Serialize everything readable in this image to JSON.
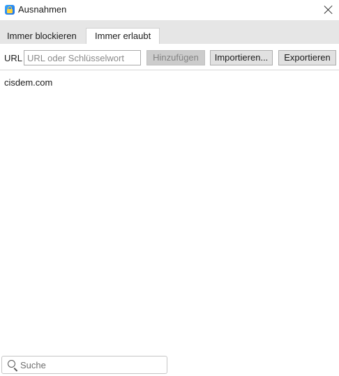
{
  "window": {
    "title": "Ausnahmen",
    "close_icon": "close-icon",
    "app_icon": "lock-icon"
  },
  "tabs": [
    {
      "label": "Immer blockieren",
      "active": false
    },
    {
      "label": "Immer erlaubt",
      "active": true
    }
  ],
  "toolbar": {
    "url_label": "URL",
    "url_value": "",
    "url_placeholder": "URL oder Schlüsselwort",
    "add_label": "Hinzufügen",
    "add_enabled": false,
    "import_label": "Importieren...",
    "export_label": "Exportieren"
  },
  "list": {
    "items": [
      "cisdem.com"
    ]
  },
  "search": {
    "placeholder": "Suche",
    "value": "",
    "icon": "search-icon"
  }
}
